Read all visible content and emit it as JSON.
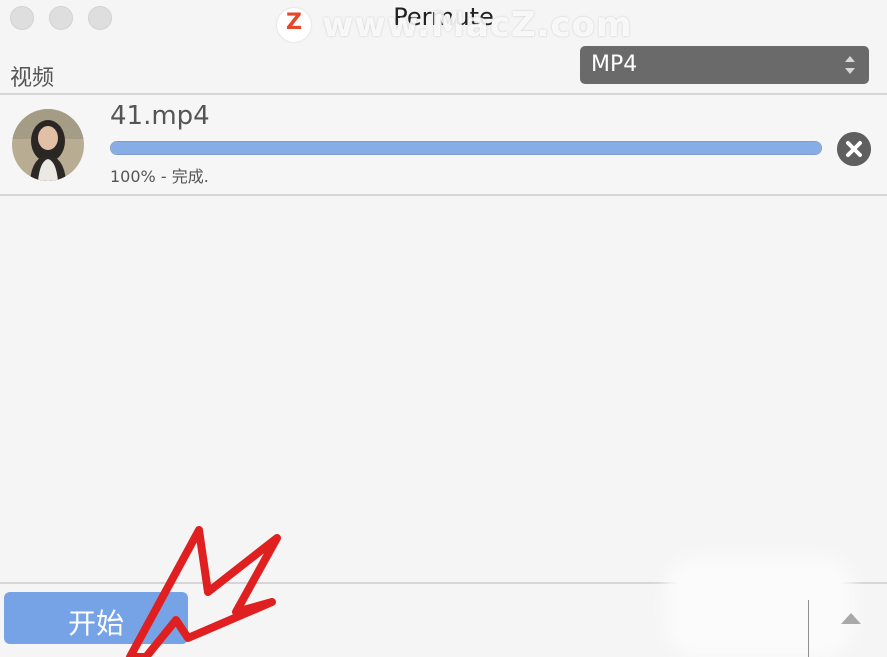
{
  "window": {
    "title": "Permute",
    "watermark_logo": "Z",
    "watermark": "www.MacZ.com"
  },
  "section_label": "视频",
  "format_select": {
    "value": "MP4",
    "icon": "up-down-chevron-icon"
  },
  "files": [
    {
      "name": "41.mp4",
      "progress": 1.0,
      "status": "100% - 完成.",
      "thumbnail": "video-thumbnail-portrait"
    }
  ],
  "toolbar": {
    "start_label": "开始",
    "expand_icon": "triangle-up-icon"
  },
  "annotation": {
    "type": "red-arrow-pointing-at-start-button",
    "color": "#e02020"
  },
  "colors": {
    "background": "#f5f5f5",
    "accent": "#75a3e6",
    "progress_fill": "#86ade6",
    "select_bg": "#6a6a6a"
  }
}
